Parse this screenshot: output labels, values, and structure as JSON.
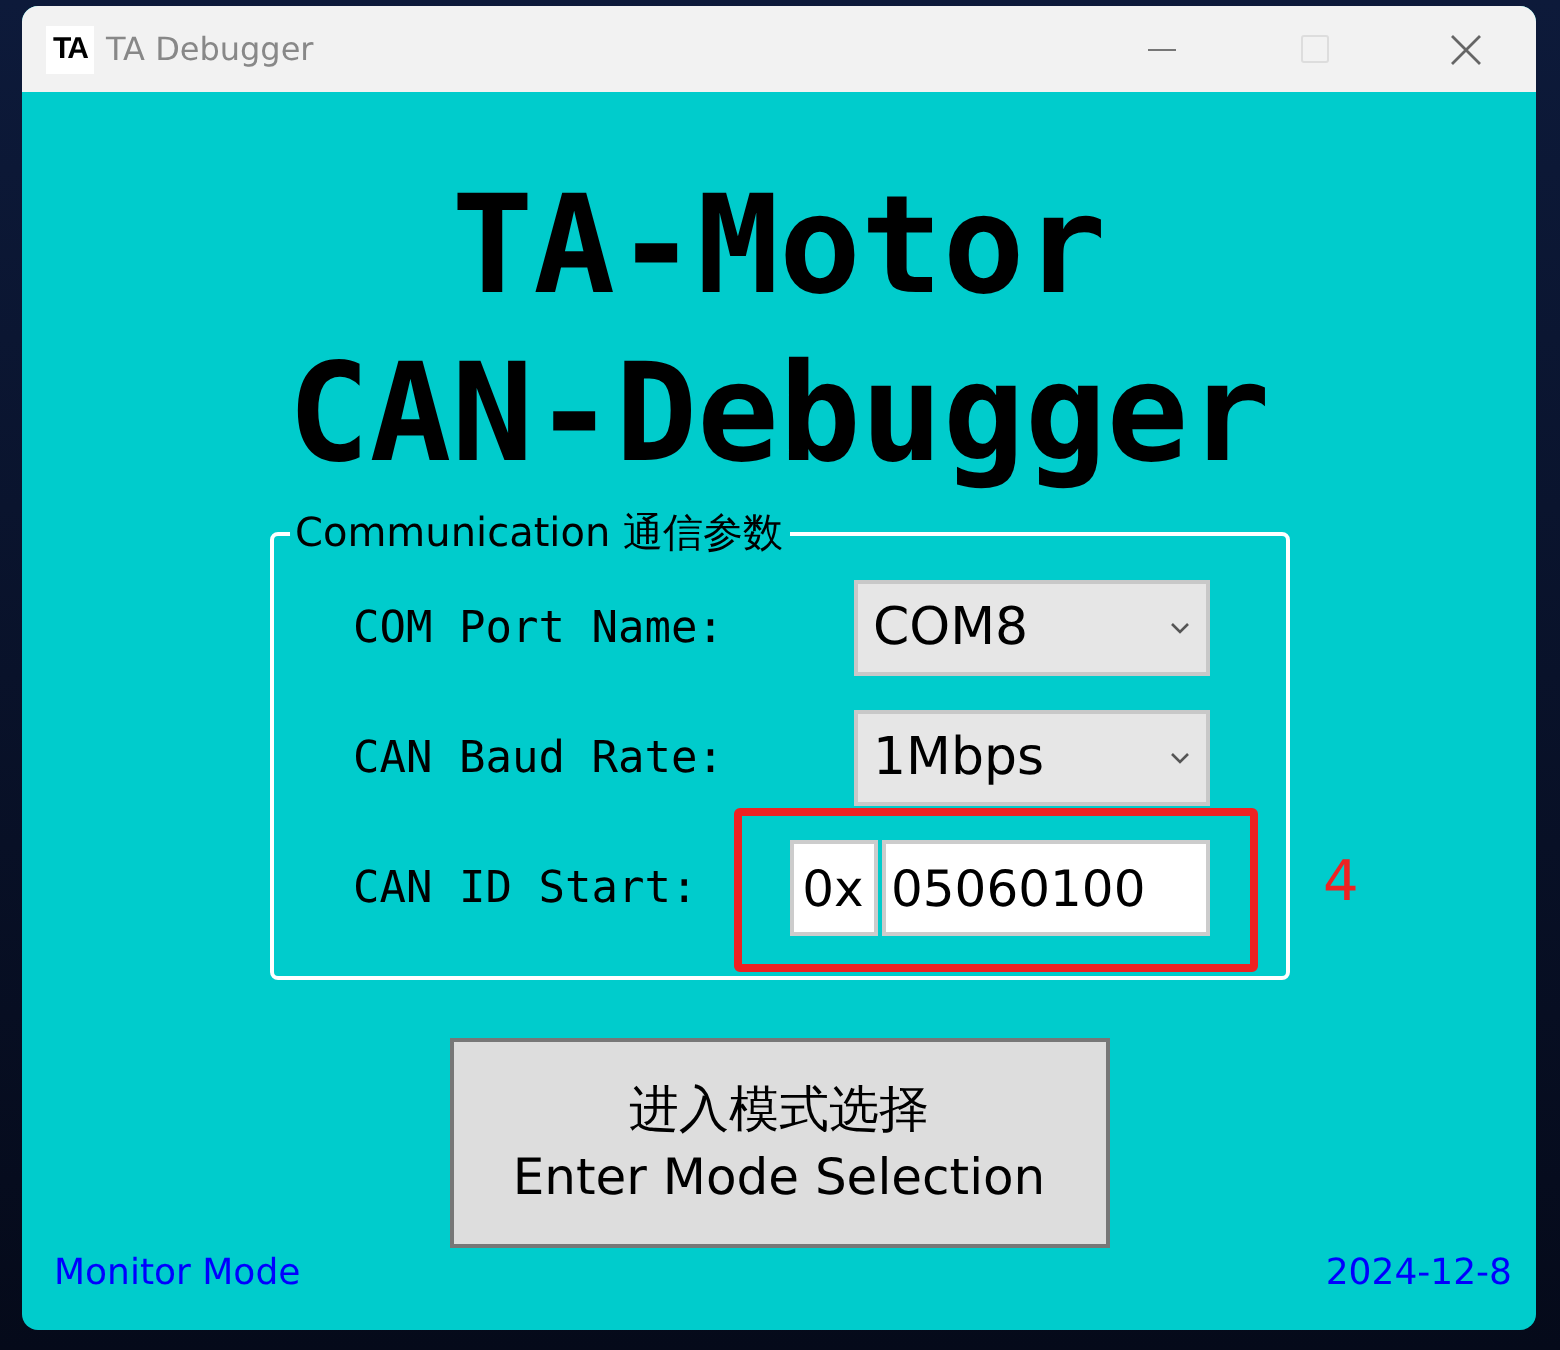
{
  "window": {
    "logo": "TA",
    "title": "TA Debugger"
  },
  "heading": [
    "TA-Motor",
    "CAN-Debugger"
  ],
  "group": {
    "legend": "Communication 通信参数",
    "rows": [
      {
        "kind": "select",
        "label": "COM Port Name:",
        "value": "COM8"
      },
      {
        "kind": "select",
        "label": "CAN Baud Rate:",
        "value": "1Mbps"
      },
      {
        "kind": "hex",
        "label": "CAN ID Start:",
        "prefix": "0x",
        "value": "05060100"
      }
    ]
  },
  "annotation": {
    "label": "4"
  },
  "button": {
    "lines": [
      "进入模式选择",
      "Enter Mode Selection"
    ]
  },
  "footer": {
    "mode": "Monitor Mode",
    "date": "2024-12-8"
  }
}
